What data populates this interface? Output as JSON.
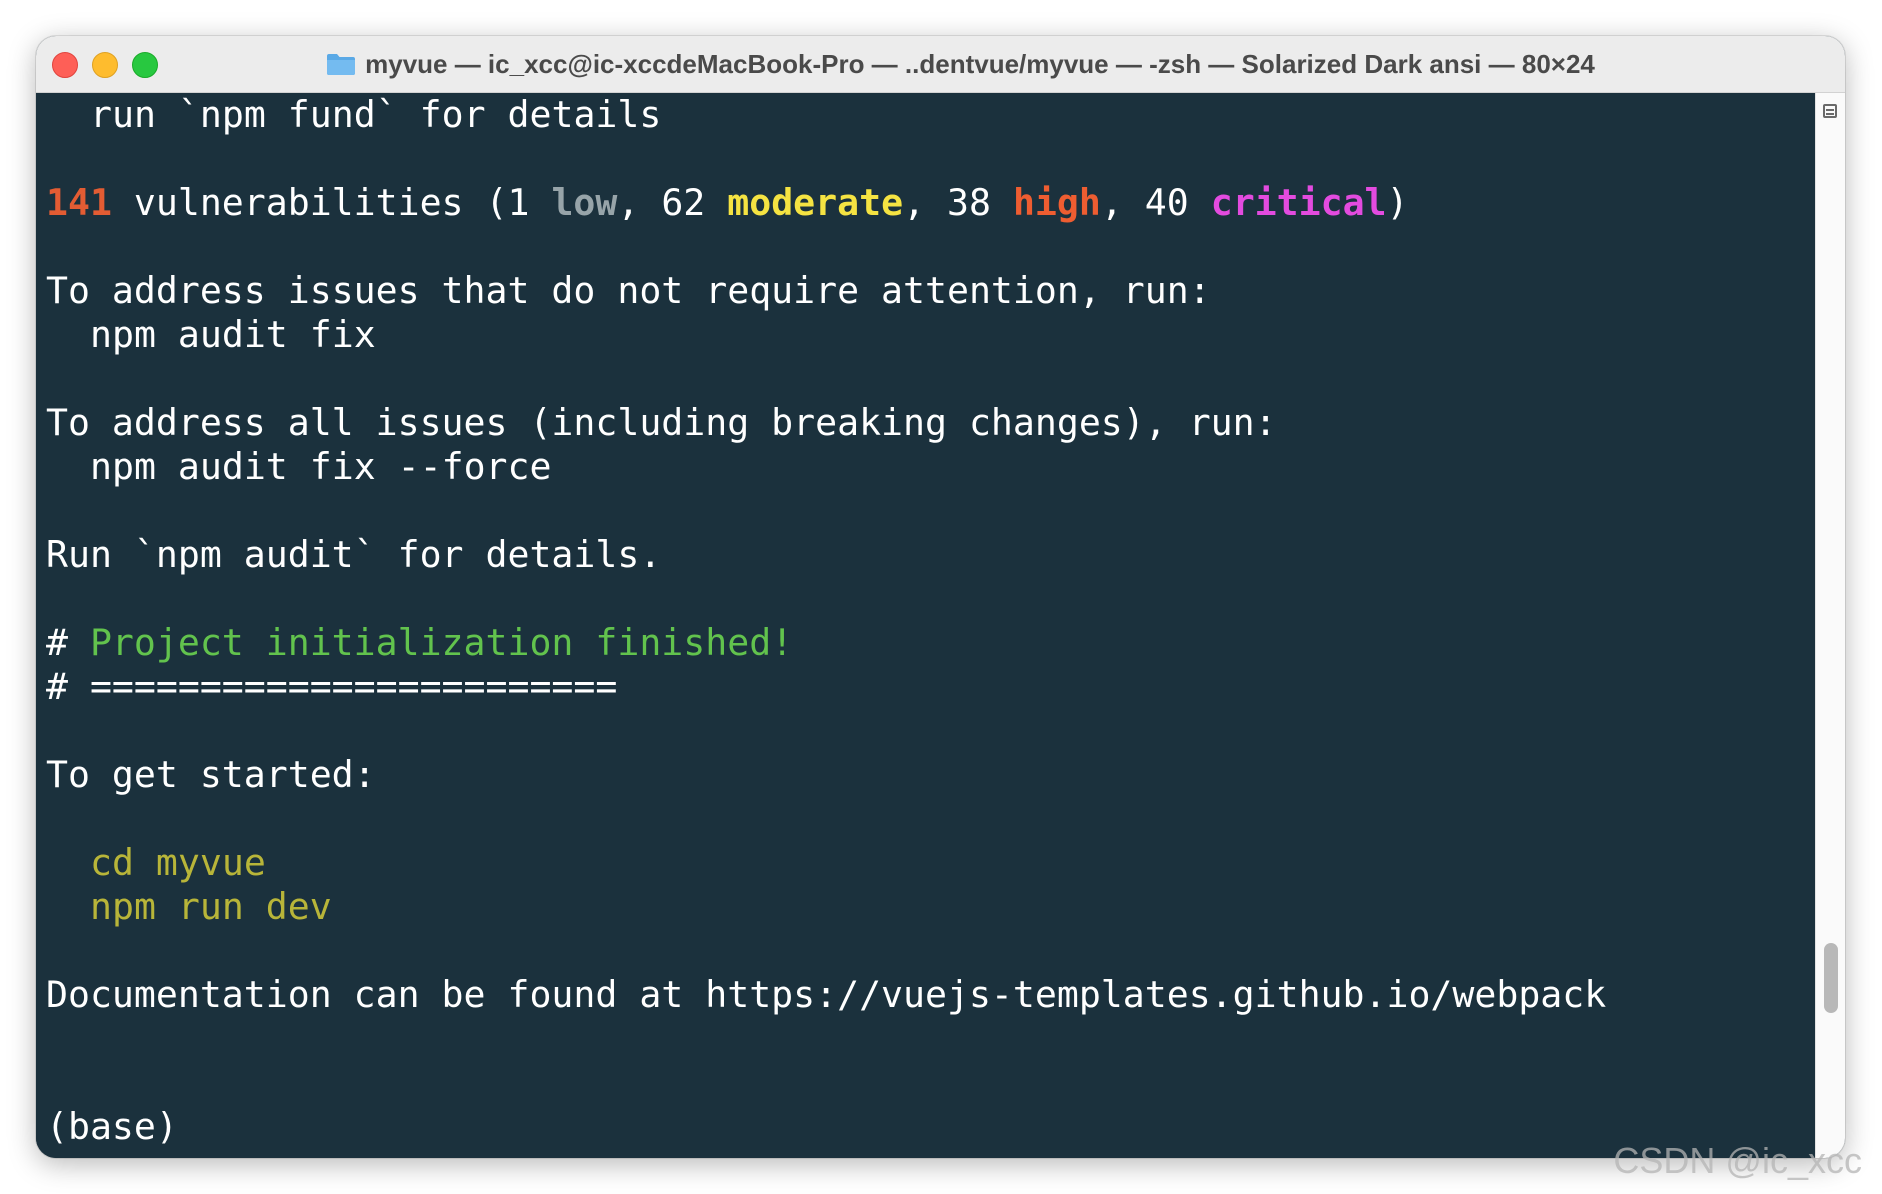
{
  "window": {
    "title": "myvue — ic_xcc@ic-xccdeMacBook-Pro — ..dentvue/myvue — -zsh — Solarized Dark ansi — 80×24",
    "folder_icon": "folder-icon"
  },
  "colors": {
    "background": "#1b313d",
    "text": "#ffffff",
    "count": "#e35c33",
    "low": "#97a4a9",
    "moderate": "#f5e342",
    "high": "#ee5d31",
    "critical": "#e34bdf",
    "heading": "#62c34d",
    "command": "#b8b539"
  },
  "terminal": {
    "fund_line": "run `npm fund` for details",
    "vuln": {
      "count": "141",
      "text_a": " vulnerabilities (1 ",
      "low": "low",
      "text_b": ", 62 ",
      "moderate": "moderate",
      "text_c": ", 38 ",
      "high": "high",
      "text_d": ", 40 ",
      "critical": "critical",
      "text_e": ")"
    },
    "address_line": "To address issues that do not require attention, run:",
    "audit_fix": "npm audit fix",
    "address_all_line": "To address all issues (including breaking changes), run:",
    "audit_fix_force": "npm audit fix --force",
    "run_audit_line": "Run `npm audit` for details.",
    "hash": "# ",
    "init_finished": "Project initialization finished!",
    "separator": "========================",
    "get_started": "To get started:",
    "cd_cmd": "cd myvue",
    "dev_cmd": "npm run dev",
    "doc_line": "Documentation can be found at https://vuejs-templates.github.io/webpack",
    "prompt": "(base)"
  },
  "watermark": "CSDN @ic_xcc"
}
